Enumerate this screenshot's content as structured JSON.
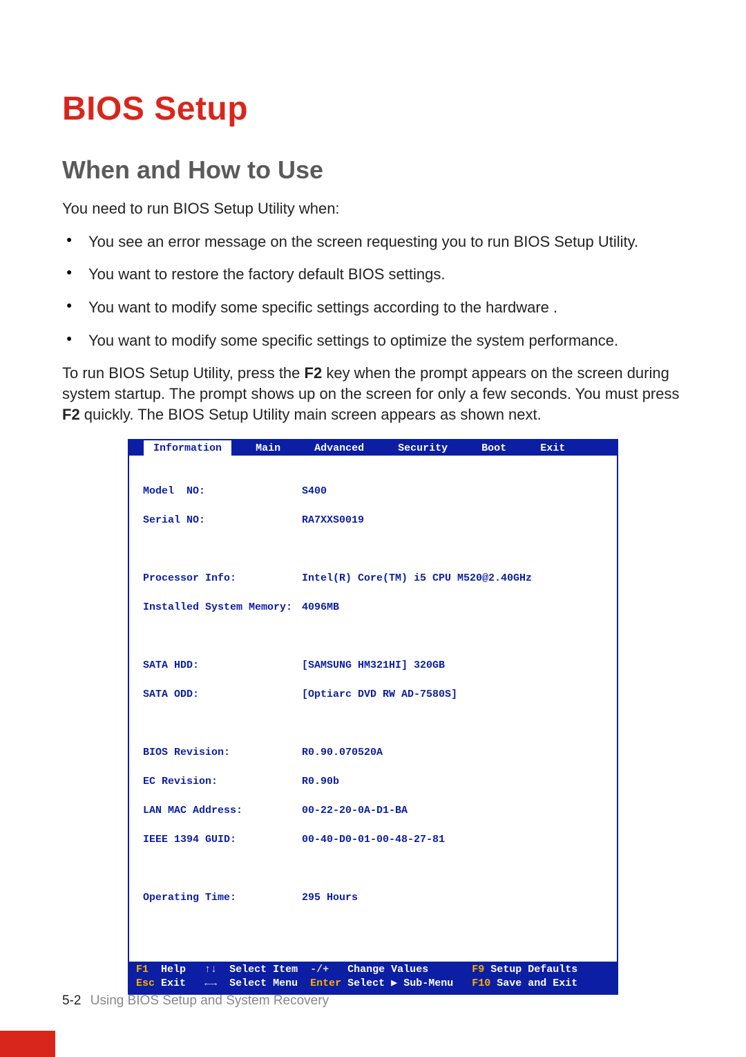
{
  "title": "BIOS Setup",
  "subheading": "When and How to Use",
  "intro": "You need to run BIOS Setup Utility when:",
  "bullets": [
    "You see an error message on the screen requesting you to run BIOS Setup Utility.",
    "You want to restore the factory default BIOS settings.",
    "You want to modify some specific settings according to the hardware .",
    "You want to modify some specific settings to optimize the system performance."
  ],
  "para2_a": "To run BIOS Setup Utility, press the ",
  "para2_key1": "F2",
  "para2_b": " key when the prompt appears on the screen during system startup. The prompt shows up on the screen for only a few seconds. You must press ",
  "para2_key2": "F2",
  "para2_c": " quickly. The BIOS Setup Utility main screen appears as shown next.",
  "bios": {
    "tabs": [
      "Information",
      "Main",
      "Advanced",
      "Security",
      "Boot",
      "Exit"
    ],
    "active_tab": "Information",
    "fields": [
      {
        "k": "Model  NO:",
        "v": "S400"
      },
      {
        "k": "Serial NO:",
        "v": "RA7XXS0019"
      },
      {
        "k": "",
        "v": ""
      },
      {
        "k": "Processor Info:",
        "v": "Intel(R) Core(TM) i5 CPU M520@2.40GHz"
      },
      {
        "k": "Installed System Memory:",
        "v": "4096MB"
      },
      {
        "k": "",
        "v": ""
      },
      {
        "k": "SATA HDD:",
        "v": "[SAMSUNG HM321HI] 320GB"
      },
      {
        "k": "SATA ODD:",
        "v": "[Optiarc DVD RW AD-7580S]"
      },
      {
        "k": "",
        "v": ""
      },
      {
        "k": "BIOS Revision:",
        "v": "R0.90.070520A"
      },
      {
        "k": "EC Revision:",
        "v": "R0.90b"
      },
      {
        "k": "LAN MAC Address:",
        "v": "00-22-20-0A-D1-BA"
      },
      {
        "k": "IEEE 1394 GUID:",
        "v": "00-40-D0-01-00-48-27-81"
      },
      {
        "k": "",
        "v": ""
      },
      {
        "k": "Operating Time:",
        "v": "295 Hours"
      }
    ],
    "footer": {
      "row1": {
        "c1k": "F1",
        "c1l": "Help",
        "c2k": "↑↓",
        "c2l": "Select Item",
        "c3k": "-/+",
        "c3l": "Change Values",
        "c4k": "F9",
        "c4l": "Setup Defaults"
      },
      "row2": {
        "c1k": "Esc",
        "c1l": "Exit",
        "c2k": "←→",
        "c2l": "Select Menu",
        "c3k": "Enter",
        "c3l": "Select ▶ Sub-Menu",
        "c4k": "F10",
        "c4l": "Save and Exit"
      }
    }
  },
  "footer": {
    "page": "5-2",
    "chapter": "Using BIOS Setup and System Recovery"
  }
}
